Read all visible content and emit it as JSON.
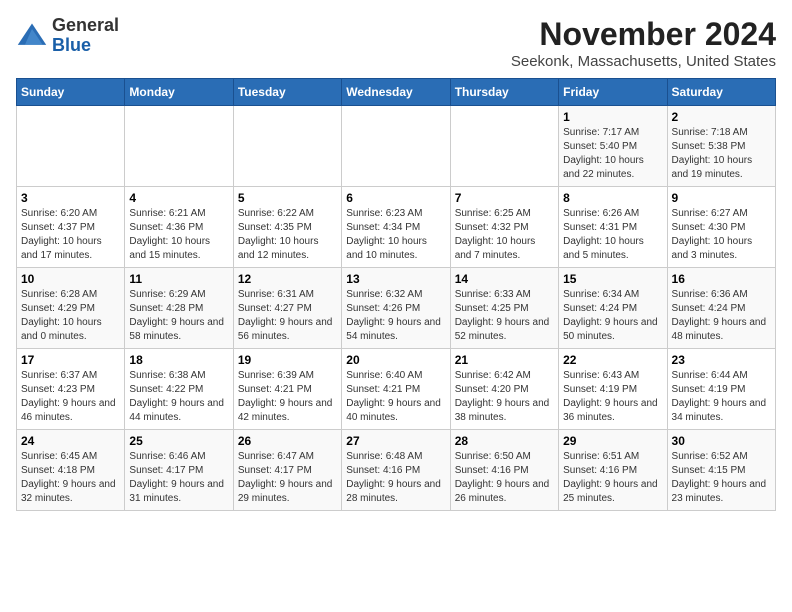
{
  "logo": {
    "general": "General",
    "blue": "Blue"
  },
  "header": {
    "month": "November 2024",
    "location": "Seekonk, Massachusetts, United States"
  },
  "weekdays": [
    "Sunday",
    "Monday",
    "Tuesday",
    "Wednesday",
    "Thursday",
    "Friday",
    "Saturday"
  ],
  "weeks": [
    [
      {
        "day": "",
        "info": ""
      },
      {
        "day": "",
        "info": ""
      },
      {
        "day": "",
        "info": ""
      },
      {
        "day": "",
        "info": ""
      },
      {
        "day": "",
        "info": ""
      },
      {
        "day": "1",
        "info": "Sunrise: 7:17 AM\nSunset: 5:40 PM\nDaylight: 10 hours and 22 minutes."
      },
      {
        "day": "2",
        "info": "Sunrise: 7:18 AM\nSunset: 5:38 PM\nDaylight: 10 hours and 19 minutes."
      }
    ],
    [
      {
        "day": "3",
        "info": "Sunrise: 6:20 AM\nSunset: 4:37 PM\nDaylight: 10 hours and 17 minutes."
      },
      {
        "day": "4",
        "info": "Sunrise: 6:21 AM\nSunset: 4:36 PM\nDaylight: 10 hours and 15 minutes."
      },
      {
        "day": "5",
        "info": "Sunrise: 6:22 AM\nSunset: 4:35 PM\nDaylight: 10 hours and 12 minutes."
      },
      {
        "day": "6",
        "info": "Sunrise: 6:23 AM\nSunset: 4:34 PM\nDaylight: 10 hours and 10 minutes."
      },
      {
        "day": "7",
        "info": "Sunrise: 6:25 AM\nSunset: 4:32 PM\nDaylight: 10 hours and 7 minutes."
      },
      {
        "day": "8",
        "info": "Sunrise: 6:26 AM\nSunset: 4:31 PM\nDaylight: 10 hours and 5 minutes."
      },
      {
        "day": "9",
        "info": "Sunrise: 6:27 AM\nSunset: 4:30 PM\nDaylight: 10 hours and 3 minutes."
      }
    ],
    [
      {
        "day": "10",
        "info": "Sunrise: 6:28 AM\nSunset: 4:29 PM\nDaylight: 10 hours and 0 minutes."
      },
      {
        "day": "11",
        "info": "Sunrise: 6:29 AM\nSunset: 4:28 PM\nDaylight: 9 hours and 58 minutes."
      },
      {
        "day": "12",
        "info": "Sunrise: 6:31 AM\nSunset: 4:27 PM\nDaylight: 9 hours and 56 minutes."
      },
      {
        "day": "13",
        "info": "Sunrise: 6:32 AM\nSunset: 4:26 PM\nDaylight: 9 hours and 54 minutes."
      },
      {
        "day": "14",
        "info": "Sunrise: 6:33 AM\nSunset: 4:25 PM\nDaylight: 9 hours and 52 minutes."
      },
      {
        "day": "15",
        "info": "Sunrise: 6:34 AM\nSunset: 4:24 PM\nDaylight: 9 hours and 50 minutes."
      },
      {
        "day": "16",
        "info": "Sunrise: 6:36 AM\nSunset: 4:24 PM\nDaylight: 9 hours and 48 minutes."
      }
    ],
    [
      {
        "day": "17",
        "info": "Sunrise: 6:37 AM\nSunset: 4:23 PM\nDaylight: 9 hours and 46 minutes."
      },
      {
        "day": "18",
        "info": "Sunrise: 6:38 AM\nSunset: 4:22 PM\nDaylight: 9 hours and 44 minutes."
      },
      {
        "day": "19",
        "info": "Sunrise: 6:39 AM\nSunset: 4:21 PM\nDaylight: 9 hours and 42 minutes."
      },
      {
        "day": "20",
        "info": "Sunrise: 6:40 AM\nSunset: 4:21 PM\nDaylight: 9 hours and 40 minutes."
      },
      {
        "day": "21",
        "info": "Sunrise: 6:42 AM\nSunset: 4:20 PM\nDaylight: 9 hours and 38 minutes."
      },
      {
        "day": "22",
        "info": "Sunrise: 6:43 AM\nSunset: 4:19 PM\nDaylight: 9 hours and 36 minutes."
      },
      {
        "day": "23",
        "info": "Sunrise: 6:44 AM\nSunset: 4:19 PM\nDaylight: 9 hours and 34 minutes."
      }
    ],
    [
      {
        "day": "24",
        "info": "Sunrise: 6:45 AM\nSunset: 4:18 PM\nDaylight: 9 hours and 32 minutes."
      },
      {
        "day": "25",
        "info": "Sunrise: 6:46 AM\nSunset: 4:17 PM\nDaylight: 9 hours and 31 minutes."
      },
      {
        "day": "26",
        "info": "Sunrise: 6:47 AM\nSunset: 4:17 PM\nDaylight: 9 hours and 29 minutes."
      },
      {
        "day": "27",
        "info": "Sunrise: 6:48 AM\nSunset: 4:16 PM\nDaylight: 9 hours and 28 minutes."
      },
      {
        "day": "28",
        "info": "Sunrise: 6:50 AM\nSunset: 4:16 PM\nDaylight: 9 hours and 26 minutes."
      },
      {
        "day": "29",
        "info": "Sunrise: 6:51 AM\nSunset: 4:16 PM\nDaylight: 9 hours and 25 minutes."
      },
      {
        "day": "30",
        "info": "Sunrise: 6:52 AM\nSunset: 4:15 PM\nDaylight: 9 hours and 23 minutes."
      }
    ]
  ]
}
